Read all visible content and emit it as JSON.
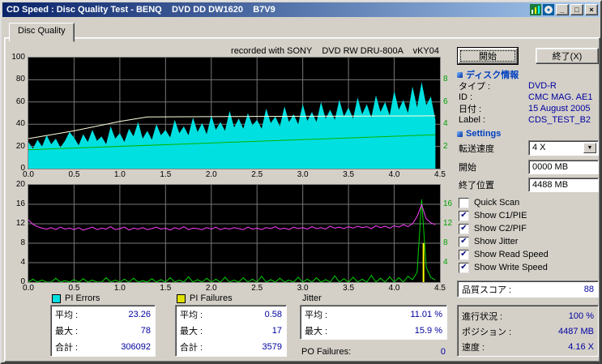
{
  "window": {
    "title": "CD Speed : Disc Quality Test - BENQ    DVD DD DW1620    B7V9",
    "controls": {
      "minimize": "_",
      "maximize": "□",
      "close": "×"
    }
  },
  "tab": {
    "label": "Disc Quality"
  },
  "recorded_with": "recorded with SONY    DVD RW DRU-800A    vKY04",
  "actions": {
    "start": "開始",
    "exit": "終了(X)"
  },
  "disc_info": {
    "header": "ディスク情報",
    "rows": [
      {
        "label": "タイプ :",
        "value": "DVD-R"
      },
      {
        "label": "ID :",
        "value": "CMC MAG. AE1"
      },
      {
        "label": "日付 :",
        "value": "15 August 2005"
      },
      {
        "label": "Label :",
        "value": "CDS_TEST_B2"
      }
    ]
  },
  "settings": {
    "header": "Settings",
    "fields": [
      {
        "label": "転送速度",
        "value": "4 X",
        "type": "combo"
      },
      {
        "label": "開始",
        "value": "0000 MB",
        "type": "text"
      },
      {
        "label": "終了位置",
        "value": "4488 MB",
        "type": "text"
      }
    ]
  },
  "checkboxes": [
    {
      "label": "Quick Scan",
      "checked": false
    },
    {
      "label": "Show C1/PIE",
      "checked": true
    },
    {
      "label": "Show C2/PIF",
      "checked": true
    },
    {
      "label": "Show Jitter",
      "checked": true
    },
    {
      "label": "Show Read Speed",
      "checked": true
    },
    {
      "label": "Show Write Speed",
      "checked": true
    }
  ],
  "quality_score": {
    "label": "品質スコア :",
    "value": "88"
  },
  "progress": {
    "rows": [
      {
        "label": "進行状況 :",
        "value": "100 %"
      },
      {
        "label": "ポジション :",
        "value": "4487 MB"
      },
      {
        "label": "速度 :",
        "value": "4.16 X"
      }
    ]
  },
  "stats": {
    "pi_errors": {
      "title": "PI Errors",
      "swatch": "#00e0e0",
      "rows": [
        {
          "label": "平均 :",
          "value": "23.26"
        },
        {
          "label": "最大 :",
          "value": "78"
        },
        {
          "label": "合計 :",
          "value": "306092"
        }
      ]
    },
    "pi_failures": {
      "title": "PI Failures",
      "swatch": "#e0e000",
      "rows": [
        {
          "label": "平均 :",
          "value": "0.58"
        },
        {
          "label": "最大 :",
          "value": "17"
        },
        {
          "label": "合計 :",
          "value": "3579"
        }
      ]
    },
    "jitter": {
      "title": "Jitter",
      "rows": [
        {
          "label": "平均 :",
          "value": "11.01 %"
        },
        {
          "label": "最大 :",
          "value": "15.9 %"
        }
      ]
    },
    "po_failures": {
      "label": "PO Failures:",
      "value": "0"
    }
  },
  "icons": {
    "check": "✔",
    "dropdown": "▼"
  },
  "colors": {
    "grid": "#777777",
    "plot_bg": "#000000",
    "right_tick": "#00a000",
    "value_text": "#0000a0",
    "header_text": "#0040c0",
    "titlebar_start": "#0a246a",
    "titlebar_end": "#a6caf0"
  },
  "chart_data": [
    {
      "name": "pi-errors-chart",
      "type": "area",
      "x_range": [
        0,
        4.5
      ],
      "y_range": [
        0,
        100
      ],
      "x_ticks": [
        0,
        0.5,
        1,
        1.5,
        2,
        2.5,
        3,
        3.5,
        4,
        4.5
      ],
      "x_tick_labels": [
        "0.0",
        "0.5",
        "1.0",
        "1.5",
        "2.0",
        "2.5",
        "3.0",
        "3.5",
        "4.0",
        "4.5"
      ],
      "y_ticks": [
        0,
        20,
        40,
        60,
        80,
        100
      ],
      "right_ticks": [
        {
          "v": 20,
          "label": "2"
        },
        {
          "v": 40,
          "label": "4"
        },
        {
          "v": 60,
          "label": "6"
        },
        {
          "v": 80,
          "label": "8"
        }
      ],
      "grid_x": [
        0.5,
        1,
        1.5,
        2,
        2.5,
        3,
        3.5,
        4
      ],
      "grid_y": [
        20,
        40,
        60,
        80
      ],
      "series": [
        {
          "name": "pi_errors",
          "kind": "area",
          "color": "#00e0e0",
          "x_step": 0.05,
          "values": [
            24,
            18,
            26,
            20,
            30,
            22,
            27,
            19,
            25,
            33,
            28,
            21,
            31,
            24,
            35,
            25,
            29,
            22,
            38,
            27,
            32,
            24,
            36,
            29,
            42,
            27,
            34,
            26,
            40,
            30,
            35,
            28,
            44,
            32,
            38,
            30,
            46,
            33,
            41,
            31,
            48,
            35,
            42,
            34,
            52,
            37,
            45,
            36,
            50,
            39,
            44,
            36,
            54,
            41,
            47,
            38,
            56,
            42,
            49,
            40,
            58,
            43,
            51,
            42,
            60,
            45,
            53,
            44,
            62,
            47,
            55,
            45,
            64,
            49,
            58,
            46,
            66,
            51,
            60,
            48,
            70,
            53,
            62,
            50,
            74,
            55,
            78,
            57,
            65,
            44
          ]
        },
        {
          "name": "read_speed",
          "kind": "line",
          "color": "#00b400",
          "points": [
            [
              0,
              17
            ],
            [
              4.45,
              30.5
            ]
          ]
        },
        {
          "name": "write_speed",
          "kind": "line",
          "color": "#ffffe0",
          "points": [
            [
              0,
              27
            ],
            [
              0.5,
              34
            ],
            [
              1,
              42.5
            ],
            [
              1.3,
              46.5
            ],
            [
              2.5,
              47
            ],
            [
              4.45,
              47.5
            ]
          ]
        }
      ]
    },
    {
      "name": "pi-failures-jitter-chart",
      "type": "line",
      "x_range": [
        0,
        4.5
      ],
      "y_range": [
        0,
        20
      ],
      "x_ticks": [
        0,
        0.5,
        1,
        1.5,
        2,
        2.5,
        3,
        3.5,
        4,
        4.5
      ],
      "x_tick_labels": [
        "0.0",
        "0.5",
        "1.0",
        "1.5",
        "2.0",
        "2.5",
        "3.0",
        "3.5",
        "4.0",
        "4.5"
      ],
      "y_ticks": [
        0,
        4,
        8,
        12,
        16,
        20
      ],
      "right_ticks": [
        {
          "v": 4,
          "label": "4"
        },
        {
          "v": 8,
          "label": "8"
        },
        {
          "v": 12,
          "label": "12"
        },
        {
          "v": 16,
          "label": "16"
        }
      ],
      "grid_x": [
        0.5,
        1,
        1.5,
        2,
        2.5,
        3,
        3.5,
        4
      ],
      "grid_y": [
        4,
        8,
        12,
        16
      ],
      "series": [
        {
          "name": "pi_failures",
          "kind": "line",
          "color": "#00d200",
          "x_step": 0.05,
          "values": [
            0,
            0.6,
            0,
            0.4,
            0,
            0,
            0.8,
            0,
            0.3,
            0,
            0.5,
            0,
            0.7,
            0,
            0.4,
            0,
            0,
            0.9,
            0,
            0.4,
            0,
            0.6,
            0,
            0.8,
            0,
            0.3,
            0,
            0.7,
            0,
            0.5,
            0,
            0.9,
            0,
            0.4,
            0,
            1.1,
            0,
            0.5,
            0,
            0.8,
            0,
            0.6,
            0,
            1.0,
            0,
            0.4,
            0,
            0.9,
            0,
            0.6,
            0,
            1.2,
            0,
            0.5,
            0,
            0.8,
            0,
            0.4,
            0,
            1.0,
            0,
            0.6,
            0,
            0.9,
            0,
            0.5,
            0,
            1.3,
            0,
            0.7,
            0,
            1.0,
            0,
            0.6,
            0,
            1.4,
            0,
            0.8,
            0,
            1.1,
            0,
            0.9,
            0,
            1.2,
            0.5,
            2.0,
            17,
            3.0,
            1.0,
            0.4
          ]
        },
        {
          "name": "po_failure_spike",
          "kind": "vlines",
          "color": "#ffff00",
          "points": [
            [
              4.32,
              8
            ]
          ]
        },
        {
          "name": "jitter",
          "kind": "line",
          "color": "#ff40ff",
          "x_step": 0.05,
          "values": [
            12.8,
            11.9,
            11.4,
            11.1,
            10.9,
            11.2,
            10.8,
            11.3,
            10.9,
            11.1,
            10.8,
            11.2,
            10.7,
            11.0,
            11.3,
            10.8,
            11.1,
            10.9,
            11.4,
            10.8,
            11.0,
            11.3,
            10.7,
            11.1,
            10.9,
            11.2,
            10.8,
            11.0,
            11.3,
            10.9,
            11.1,
            10.7,
            11.2,
            10.9,
            11.4,
            10.8,
            11.1,
            11.0,
            10.8,
            11.2,
            10.9,
            11.3,
            10.8,
            11.1,
            10.9,
            11.2,
            11.0,
            10.8,
            11.3,
            10.9,
            11.1,
            10.8,
            11.2,
            11.0,
            11.4,
            10.9,
            11.1,
            10.8,
            11.3,
            11.0,
            11.2,
            10.9,
            11.4,
            11.0,
            11.2,
            10.9,
            11.5,
            11.1,
            11.3,
            11.0,
            11.4,
            11.1,
            11.5,
            11.2,
            11.4,
            11.0,
            11.6,
            11.2,
            11.5,
            11.1,
            11.6,
            11.3,
            11.8,
            11.4,
            12.0,
            13.5,
            15.9,
            13.0,
            12.2,
            11.8
          ]
        }
      ]
    }
  ]
}
